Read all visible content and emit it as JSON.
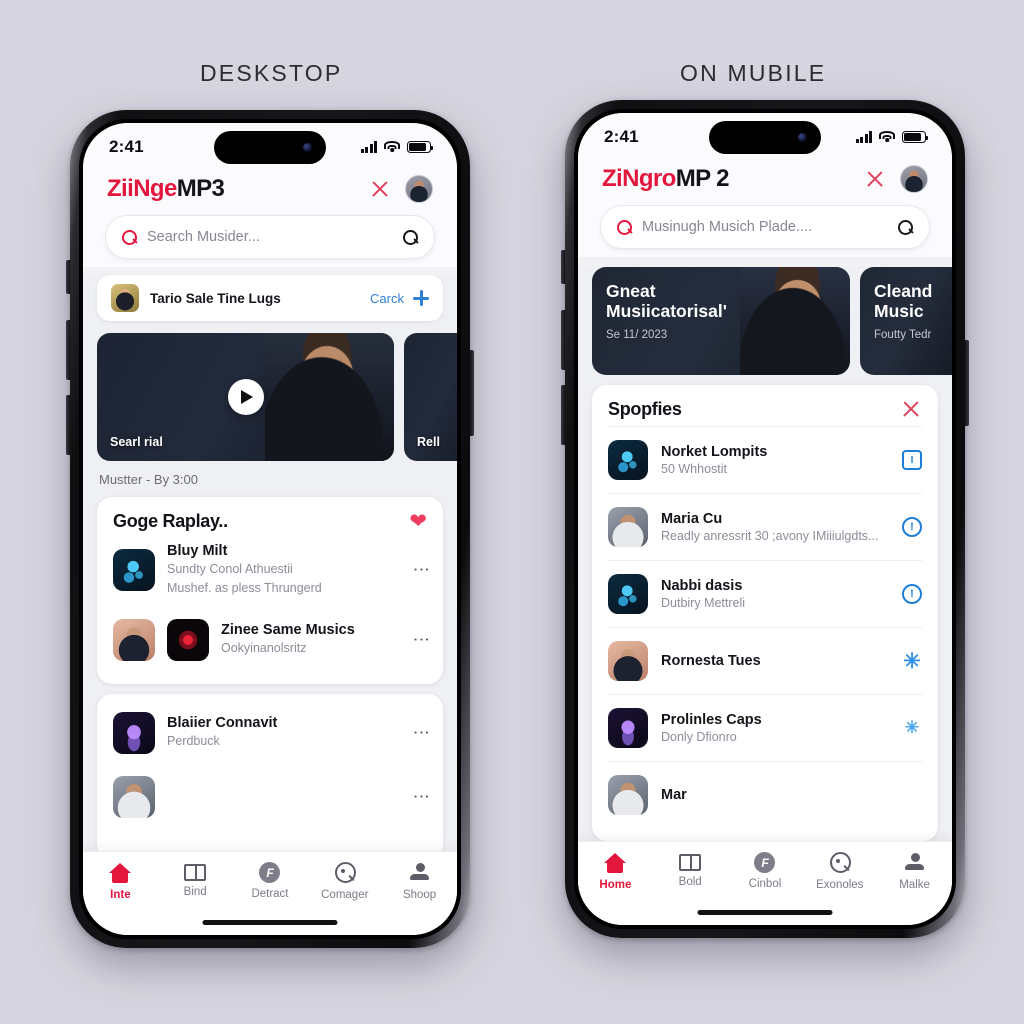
{
  "captions": {
    "left": "DESKSTOP",
    "right": "ON MUBILE"
  },
  "left_phone": {
    "status": {
      "time": "2:41",
      "signal_icon": "cellular-bars-icon",
      "wifi_icon": "wifi-icon",
      "battery_icon": "battery-icon"
    },
    "header": {
      "logo_red": "ZiiNge",
      "logo_black": "MP3",
      "close_icon": "close-icon",
      "avatar": "user-avatar"
    },
    "search": {
      "placeholder": "Search Musider...",
      "leading_icon": "search-icon",
      "trailing_icon": "search-icon"
    },
    "pill": {
      "title": "Tario Sale Tine Lugs",
      "link": "Carck",
      "plus_icon": "plus-icon",
      "thumb": "thumbnail"
    },
    "videos": [
      {
        "label": "Searl rial",
        "play_icon": "play-icon"
      },
      {
        "label": "Rell"
      }
    ],
    "video_meta": "Mustter  -  By 3:00",
    "card": {
      "title": "Goge Raplay..",
      "favorite_icon": "heart-icon",
      "rows": [
        {
          "title": "Bluy Milt",
          "sub1": "Sundty Conol Athuestii",
          "sub2": "Mushef. as pless Thrungerd",
          "menu_icon": "more-vertical-icon"
        },
        {
          "title": "Zinee Same Musics",
          "sub1": "Ookyinanolsritz",
          "menu_icon": "more-vertical-icon"
        }
      ]
    },
    "card2": {
      "rows": [
        {
          "title": "Blaiier Connavit",
          "sub1": "Perdbuck",
          "menu_icon": "more-vertical-icon"
        }
      ]
    },
    "tabs": [
      {
        "label": "Inte",
        "icon": "home-icon",
        "active": true
      },
      {
        "label": "Bind",
        "icon": "book-icon",
        "active": false
      },
      {
        "label": "Detract",
        "icon": "f-circle-icon",
        "active": false
      },
      {
        "label": "Comager",
        "icon": "search-circle-icon",
        "active": false
      },
      {
        "label": "Shoop",
        "icon": "person-icon",
        "active": false
      }
    ]
  },
  "right_phone": {
    "status": {
      "time": "2:41",
      "signal_icon": "cellular-bars-icon",
      "wifi_icon": "wifi-icon",
      "battery_icon": "battery-icon"
    },
    "header": {
      "logo_red": "ZiNgro",
      "logo_black": "MP 2",
      "close_icon": "close-icon",
      "avatar": "user-avatar"
    },
    "search": {
      "placeholder": "Musinugh Musich Plade....",
      "leading_icon": "search-icon",
      "trailing_icon": "search-icon"
    },
    "banners": [
      {
        "title_line1": "Gneat",
        "title_line2": "Musiicatorisal'",
        "sub": "Se 11/ 2023"
      },
      {
        "title_line1": "Cleand",
        "title_line2": "Music",
        "sub": "Foutty Tedr"
      }
    ],
    "list": {
      "title": "Spopfies",
      "close_icon": "close-icon",
      "rows": [
        {
          "title": "Norket Lompits",
          "sub": "50 Whhostit",
          "action_icon": "square-info-icon",
          "action_glyph": "I"
        },
        {
          "title": "Maria Cu",
          "sub": "Readly anressrit 30 ;avony IMiiiulgdts...",
          "action_icon": "clock-icon",
          "action_glyph": "!"
        },
        {
          "title": "Nabbi dasis",
          "sub": "Dutbiry Mettreli",
          "action_icon": "info-circle-icon",
          "action_glyph": "!"
        },
        {
          "title": "Rornesta Tues",
          "sub": "",
          "action_icon": "asterisk-icon",
          "action_glyph": "✳"
        },
        {
          "title": "Prolinles Caps",
          "sub": "Donly Dfionro",
          "action_icon": "asterisk-icon",
          "action_glyph": "✳"
        },
        {
          "title": "Mar",
          "sub": "",
          "action_icon": "",
          "action_glyph": ""
        }
      ]
    },
    "tabs": [
      {
        "label": "Home",
        "icon": "home-icon",
        "active": true
      },
      {
        "label": "Bold",
        "icon": "book-icon",
        "active": false
      },
      {
        "label": "Cinbol",
        "icon": "f-circle-icon",
        "active": false
      },
      {
        "label": "Exonoles",
        "icon": "search-circle-icon",
        "active": false
      },
      {
        "label": "Malke",
        "icon": "person-icon",
        "active": false
      }
    ]
  },
  "colors": {
    "background": "#d6d5df",
    "brand_red": "#e3173e",
    "link_blue": "#2f7fd6",
    "action_blue": "#1f7fd8",
    "heart_red": "#ee3b5e",
    "card_white": "#ffffff",
    "screen_gray": "#eff0f3"
  }
}
